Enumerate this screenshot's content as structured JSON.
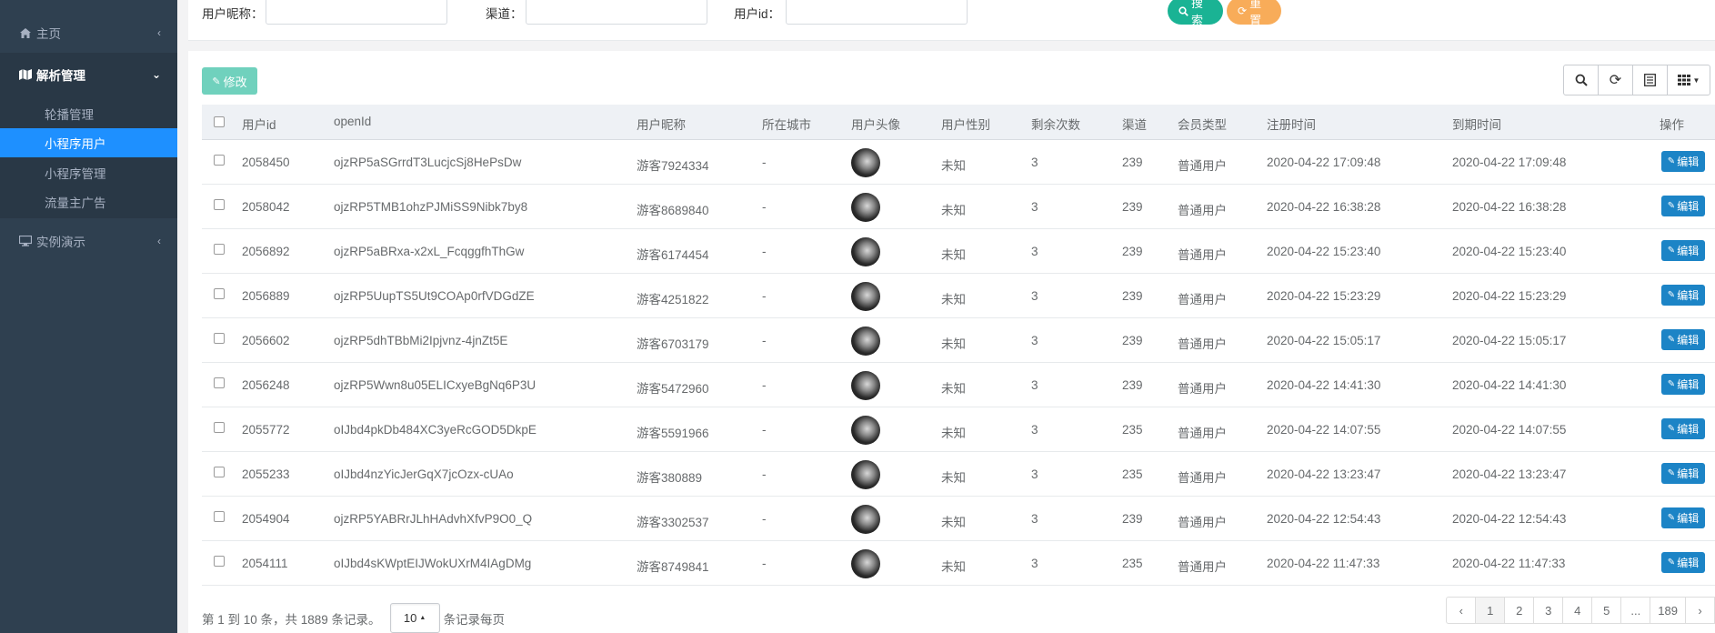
{
  "sidebar": {
    "home": "主页",
    "parse_mgmt": "解析管理",
    "sub_items": [
      "轮播管理",
      "小程序用户",
      "小程序管理",
      "流量主广告"
    ],
    "demo": "实例演示"
  },
  "search": {
    "nickname_label": "用户昵称：",
    "channel_label": "渠道：",
    "userid_label": "用户id：",
    "search_btn": "搜索",
    "reset_btn": "重置"
  },
  "toolbar": {
    "edit_btn": "修改"
  },
  "table": {
    "headers": [
      "用户id",
      "openId",
      "用户昵称",
      "所在城市",
      "用户头像",
      "用户性别",
      "剩余次数",
      "渠道",
      "会员类型",
      "注册时间",
      "到期时间",
      "操作"
    ],
    "edit_label": "编辑",
    "rows": [
      {
        "id": "2058450",
        "openid": "ojzRP5aSGrrdT3LucjcSj8HePsDw",
        "nickname": "游客7924334",
        "city": "-",
        "gender": "未知",
        "remaining": "3",
        "channel": "239",
        "member": "普通用户",
        "reg": "2020-04-22 17:09:48",
        "exp": "2020-04-22 17:09:48"
      },
      {
        "id": "2058042",
        "openid": "ojzRP5TMB1ohzPJMiSS9Nibk7by8",
        "nickname": "游客8689840",
        "city": "-",
        "gender": "未知",
        "remaining": "3",
        "channel": "239",
        "member": "普通用户",
        "reg": "2020-04-22 16:38:28",
        "exp": "2020-04-22 16:38:28"
      },
      {
        "id": "2056892",
        "openid": "ojzRP5aBRxa-x2xL_FcqggfhThGw",
        "nickname": "游客6174454",
        "city": "-",
        "gender": "未知",
        "remaining": "3",
        "channel": "239",
        "member": "普通用户",
        "reg": "2020-04-22 15:23:40",
        "exp": "2020-04-22 15:23:40"
      },
      {
        "id": "2056889",
        "openid": "ojzRP5UupTS5Ut9COAp0rfVDGdZE",
        "nickname": "游客4251822",
        "city": "-",
        "gender": "未知",
        "remaining": "3",
        "channel": "239",
        "member": "普通用户",
        "reg": "2020-04-22 15:23:29",
        "exp": "2020-04-22 15:23:29"
      },
      {
        "id": "2056602",
        "openid": "ojzRP5dhTBbMi2Ipjvnz-4jnZt5E",
        "nickname": "游客6703179",
        "city": "-",
        "gender": "未知",
        "remaining": "3",
        "channel": "239",
        "member": "普通用户",
        "reg": "2020-04-22 15:05:17",
        "exp": "2020-04-22 15:05:17"
      },
      {
        "id": "2056248",
        "openid": "ojzRP5Wwn8u05ELICxyeBgNq6P3U",
        "nickname": "游客5472960",
        "city": "-",
        "gender": "未知",
        "remaining": "3",
        "channel": "239",
        "member": "普通用户",
        "reg": "2020-04-22 14:41:30",
        "exp": "2020-04-22 14:41:30"
      },
      {
        "id": "2055772",
        "openid": "oIJbd4pkDb484XC3yeRcGOD5DkpE",
        "nickname": "游客5591966",
        "city": "-",
        "gender": "未知",
        "remaining": "3",
        "channel": "235",
        "member": "普通用户",
        "reg": "2020-04-22 14:07:55",
        "exp": "2020-04-22 14:07:55"
      },
      {
        "id": "2055233",
        "openid": "oIJbd4nzYicJerGqX7jcOzx-cUAo",
        "nickname": "游客380889",
        "city": "-",
        "gender": "未知",
        "remaining": "3",
        "channel": "235",
        "member": "普通用户",
        "reg": "2020-04-22 13:23:47",
        "exp": "2020-04-22 13:23:47"
      },
      {
        "id": "2054904",
        "openid": "ojzRP5YABRrJLhHAdvhXfvP9O0_Q",
        "nickname": "游客3302537",
        "city": "-",
        "gender": "未知",
        "remaining": "3",
        "channel": "239",
        "member": "普通用户",
        "reg": "2020-04-22 12:54:43",
        "exp": "2020-04-22 12:54:43"
      },
      {
        "id": "2054111",
        "openid": "oIJbd4sKWptEIJWokUXrM4IAgDMg",
        "nickname": "游客8749841",
        "city": "-",
        "gender": "未知",
        "remaining": "3",
        "channel": "235",
        "member": "普通用户",
        "reg": "2020-04-22 11:47:33",
        "exp": "2020-04-22 11:47:33"
      }
    ]
  },
  "footer": {
    "info_prefix": "第 1 到 10 条，共 1889 条记录。",
    "page_size": "10",
    "info_suffix": "条记录每页",
    "pages": [
      "‹",
      "1",
      "2",
      "3",
      "4",
      "5",
      "...",
      "189",
      "›"
    ]
  },
  "colors": {
    "sidebar_bg": "#2f4050",
    "active_item": "#1e90ff",
    "search_btn": "#1ab394",
    "reset_btn": "#f8ac59",
    "edit_btn": "#1c84c6"
  }
}
